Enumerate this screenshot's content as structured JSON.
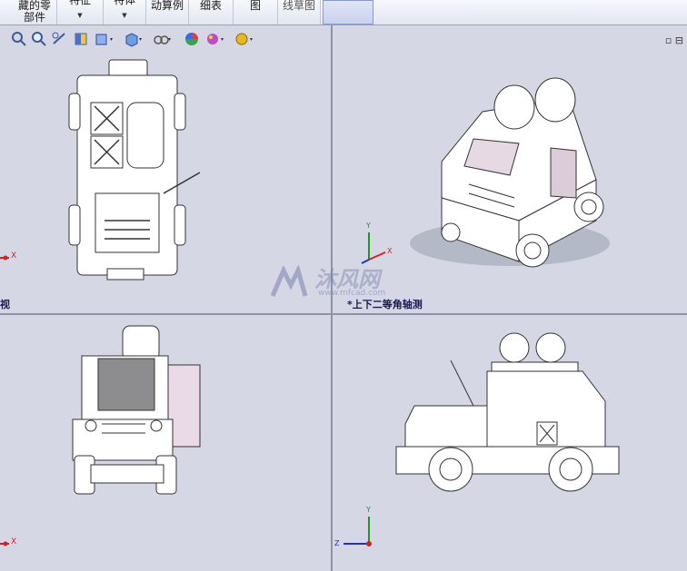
{
  "ribbon": {
    "items": [
      {
        "l1": "藏的零",
        "l2": "部件",
        "arrow": false
      },
      {
        "l1": "特征",
        "l2": "",
        "arrow": true
      },
      {
        "l1": "特体",
        "l2": "",
        "arrow": true
      },
      {
        "l1": "动算例",
        "l2": "",
        "arrow": false
      },
      {
        "l1": "细表",
        "l2": "",
        "arrow": false
      },
      {
        "l1": "图",
        "l2": "",
        "arrow": false
      },
      {
        "l1": "线草图",
        "l2": "",
        "arrow": false
      }
    ]
  },
  "view_toolbar": {
    "icons": [
      "zoom-to-fit-icon",
      "zoom-to-area-icon",
      "previous-view-icon",
      "section-view-icon",
      "view-orientation-icon",
      "display-style-icon",
      "hide-show-items-icon",
      "edit-appearance-icon",
      "apply-scene-icon",
      "view-settings-icon"
    ]
  },
  "viewports": {
    "top_left": {
      "caption": "视"
    },
    "top_right": {
      "caption": "*上下二等角轴测"
    },
    "bottom_left": {
      "caption": ""
    },
    "bottom_right": {
      "caption": ""
    }
  },
  "axes": {
    "x": "X",
    "y": "Y",
    "z": "Z"
  },
  "watermark": {
    "text": "沐风网",
    "sub": "www.mfcad.com"
  },
  "colors": {
    "x_axis": "#d42020",
    "y_axis": "#1a9a1a",
    "z_axis": "#2030c0",
    "viewport_bg": "#d5d8e4"
  }
}
